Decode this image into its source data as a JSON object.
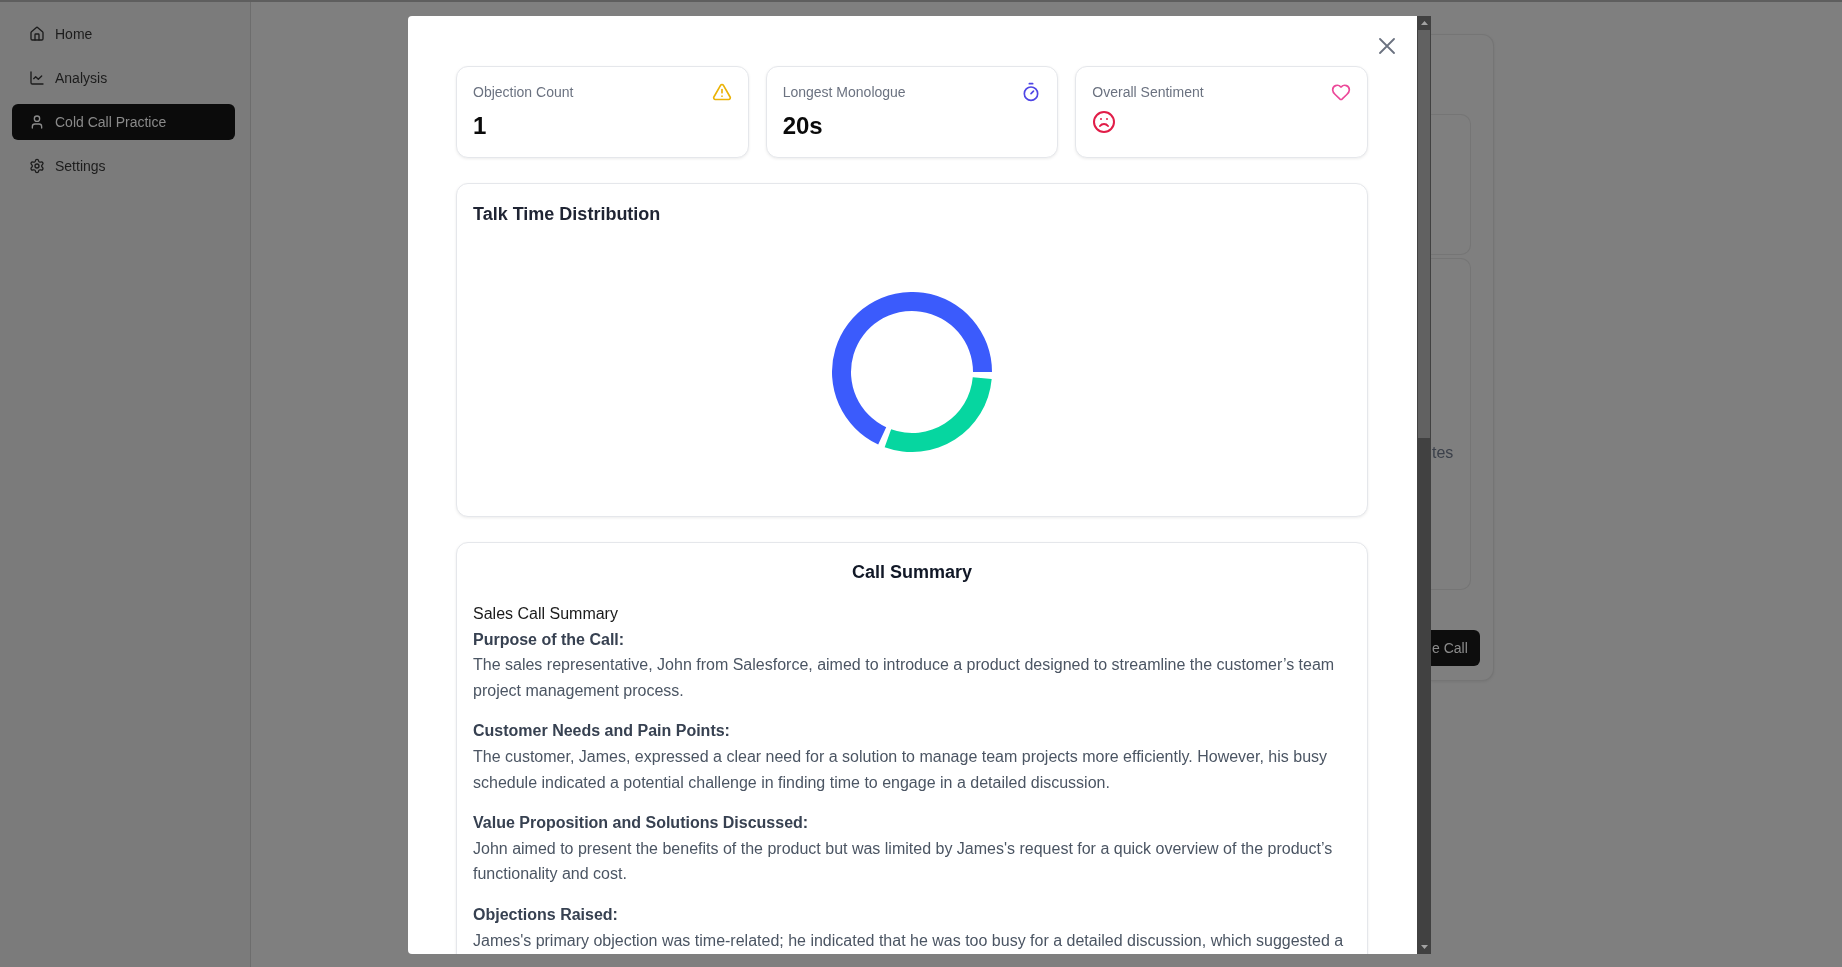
{
  "sidebar": {
    "items": [
      {
        "label": "Home",
        "selected": false
      },
      {
        "label": "Analysis",
        "selected": false
      },
      {
        "label": "Cold Call Practice",
        "selected": true
      },
      {
        "label": "Settings",
        "selected": false
      }
    ]
  },
  "background_page": {
    "fragment_text": "tes",
    "button": "e Call"
  },
  "modal": {
    "metrics": [
      {
        "kind": "count",
        "label": "Objection Count",
        "value": "1"
      },
      {
        "kind": "duration",
        "label": "Longest Monologue",
        "value": "20s"
      },
      {
        "kind": "sentiment",
        "label": "Overall Sentiment"
      }
    ],
    "talk_time": {
      "title": "Talk Time Distribution"
    },
    "summary": {
      "heading": "Call Summary",
      "title": "Sales Call Summary",
      "sections": [
        {
          "heading": "Purpose of the Call:",
          "body": "The sales representative, John from Salesforce, aimed to introduce a product designed to streamline the customer’s team project management process."
        },
        {
          "heading": "Customer Needs and Pain Points:",
          "body": "The customer, James, expressed a clear need for a solution to manage team projects more efficiently. However, his busy schedule indicated a potential challenge in finding time to engage in a detailed discussion."
        },
        {
          "heading": "Value Proposition and Solutions Discussed:",
          "body": "John aimed to present the benefits of the product but was limited by James's request for a quick overview of the product’s functionality and cost."
        },
        {
          "heading": "Objections Raised:",
          "body": "James's primary objection was time-related; he indicated that he was too busy for a detailed discussion, which suggested a"
        }
      ]
    }
  }
}
